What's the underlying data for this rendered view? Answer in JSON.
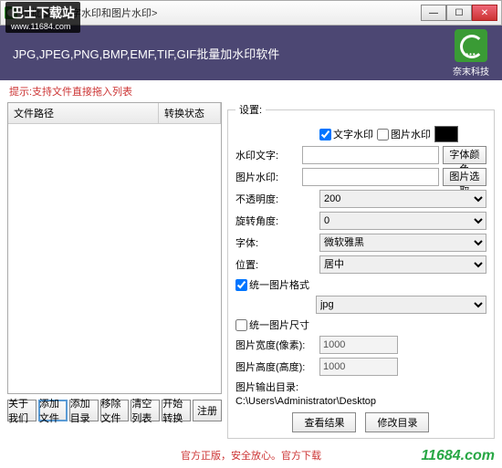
{
  "overlay": {
    "title": "巴士下载站",
    "url": "www.11684.com",
    "footerbrand": "11684.com"
  },
  "titlebar": {
    "text": "持批量加文字水印和图片水印>"
  },
  "banner": {
    "text": "JPG,JPEG,PNG,BMP,EMF,TIF,GIF批量加水印软件",
    "brand": "奈末科技"
  },
  "hint": "提示:支持文件直接拖入列表",
  "table": {
    "col_path": "文件路径",
    "col_status": "转换状态"
  },
  "buttons": {
    "about": "关于我们",
    "addfile": "添加文件",
    "adddir": "添加目录",
    "remove": "移除文件",
    "clear": "清空列表",
    "start": "开始转换",
    "register": "注册"
  },
  "settings": {
    "legend": "设置:",
    "ck_text": "文字水印",
    "ck_img": "图片水印",
    "lbl_text": "水印文字:",
    "btn_fontcolor": "字体颜色",
    "lbl_img": "图片水印:",
    "btn_pickimg": "图片选取",
    "lbl_opacity": "不透明度:",
    "opacity_val": "200",
    "lbl_rotate": "旋转角度:",
    "rotate_val": "0",
    "lbl_font": "字体:",
    "font_val": "微软雅黑",
    "lbl_pos": "位置:",
    "pos_val": "居中",
    "ck_fmt": "统一图片格式",
    "fmt_val": "jpg",
    "ck_size": "统一图片尺寸",
    "lbl_w": "图片宽度(像素):",
    "w_val": "1000",
    "lbl_h": "图片高度(高度):",
    "h_val": "1000",
    "lbl_outdir": "图片输出目录:",
    "outdir_val": "C:\\Users\\Administrator\\Desktop",
    "btn_view": "查看结果",
    "btn_changedir": "修改目录"
  },
  "footer": {
    "red": "官方正版，安全放心。官方下载",
    "grey": ""
  }
}
